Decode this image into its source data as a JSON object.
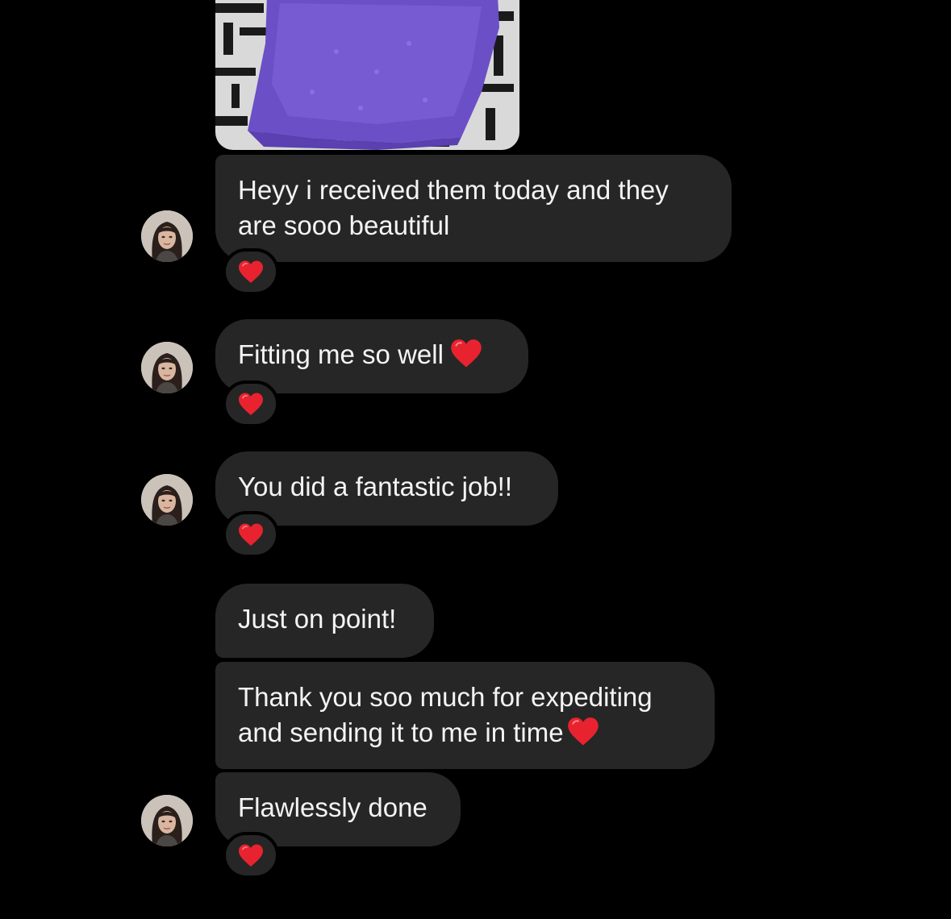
{
  "chat": {
    "reaction_icon": "red-heart",
    "heart_color": "#e8232f",
    "bubble_color": "#262626",
    "background": "#000000",
    "messages": [
      {
        "line1": "Heyy i received them today and they",
        "line2": "are sooo beautiful"
      },
      {
        "text": "Fitting me so well"
      },
      {
        "text": "You did a fantastic job!!"
      },
      {
        "text": "Just on point!"
      },
      {
        "line1": "Thank you soo much for expediting",
        "line2": "and sending it to me in time"
      },
      {
        "text": "Flawlessly done"
      }
    ]
  }
}
